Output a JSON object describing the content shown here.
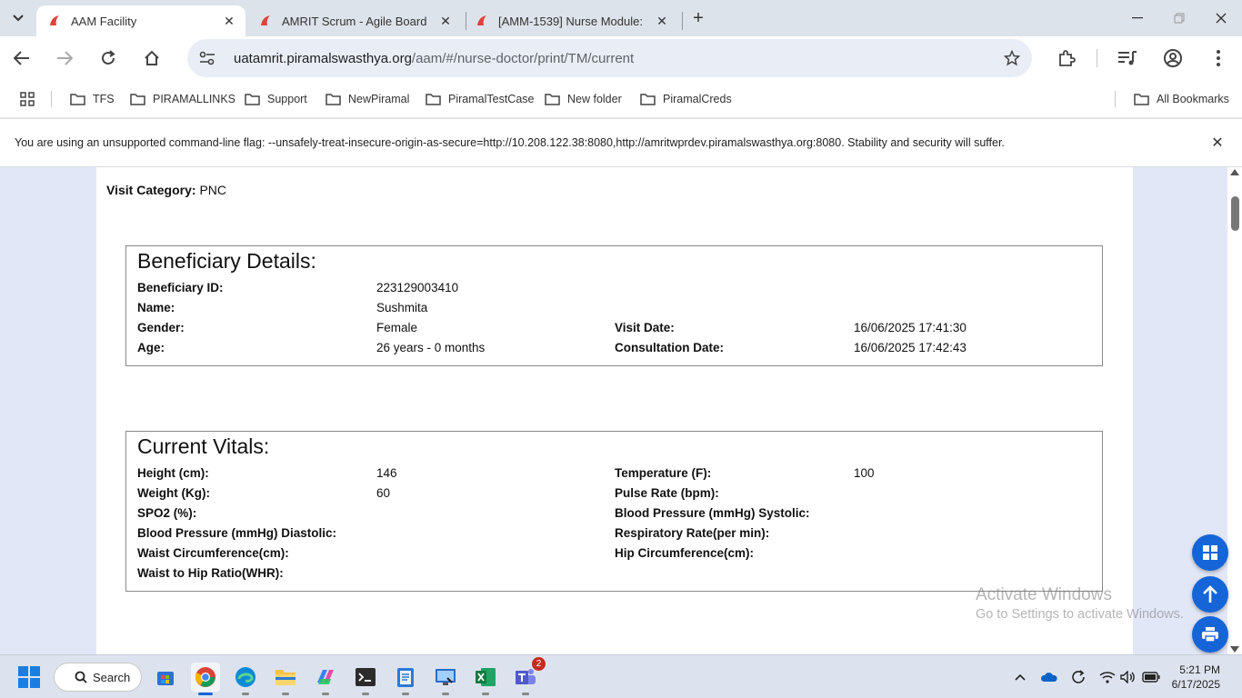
{
  "browser": {
    "tabs": [
      {
        "title": "AAM Facility",
        "active": true
      },
      {
        "title": "AMRIT Scrum - Agile Board",
        "active": false
      },
      {
        "title": "[AMM-1539] Nurse Module:",
        "active": false
      }
    ],
    "url_host": "uatamrit.piramalswasthya.org",
    "url_path": "/aam/#/nurse-doctor/print/TM/current",
    "bookmarks": [
      "TFS",
      "PIRAMALLINKS",
      "Support",
      "NewPiramal",
      "PiramalTestCase",
      "New folder",
      "PiramalCreds"
    ],
    "all_bookmarks": "All Bookmarks",
    "infobar_message": "You are using an unsupported command-line flag: --unsafely-treat-insecure-origin-as-secure=http://10.208.122.38:8080,http://amritwprdev.piramalswasthya.org:8080. Stability and security will suffer."
  },
  "page": {
    "visit_category_label": "Visit Category:",
    "visit_category_value": "PNC",
    "beneficiary": {
      "title": "Beneficiary Details:",
      "id_label": "Beneficiary ID:",
      "id_value": "223129003410",
      "name_label": "Name:",
      "name_value": "Sushmita",
      "gender_label": "Gender:",
      "gender_value": "Female",
      "age_label": "Age:",
      "age_value": "26 years - 0 months",
      "visit_date_label": "Visit Date:",
      "visit_date_value": "16/06/2025 17:41:30",
      "consult_date_label": "Consultation Date:",
      "consult_date_value": "16/06/2025 17:42:43"
    },
    "vitals": {
      "title": "Current Vitals:",
      "height_label": "Height (cm):",
      "height_value": "146",
      "weight_label": "Weight (Kg):",
      "weight_value": "60",
      "spo2_label": "SPO2 (%):",
      "bp_dia_label": "Blood Pressure (mmHg) Diastolic:",
      "waist_label": "Waist Circumference(cm):",
      "whr_label": "Waist to Hip Ratio(WHR):",
      "temp_label": "Temperature (F):",
      "temp_value": "100",
      "pulse_label": "Pulse Rate (bpm):",
      "bp_sys_label": "Blood Pressure (mmHg) Systolic:",
      "resp_label": "Respiratory Rate(per min):",
      "hip_label": "Hip Circumference(cm):"
    }
  },
  "watermark": {
    "line1": "Activate Windows",
    "line2": "Go to Settings to activate Windows."
  },
  "taskbar": {
    "search_label": "Search",
    "teams_badge": "2",
    "time": "5:21 PM",
    "date": "6/17/2025"
  },
  "colors": {
    "accent": "#1565d8",
    "page_bg": "#e2e7f8",
    "chrome_bg": "#dde3ea"
  }
}
